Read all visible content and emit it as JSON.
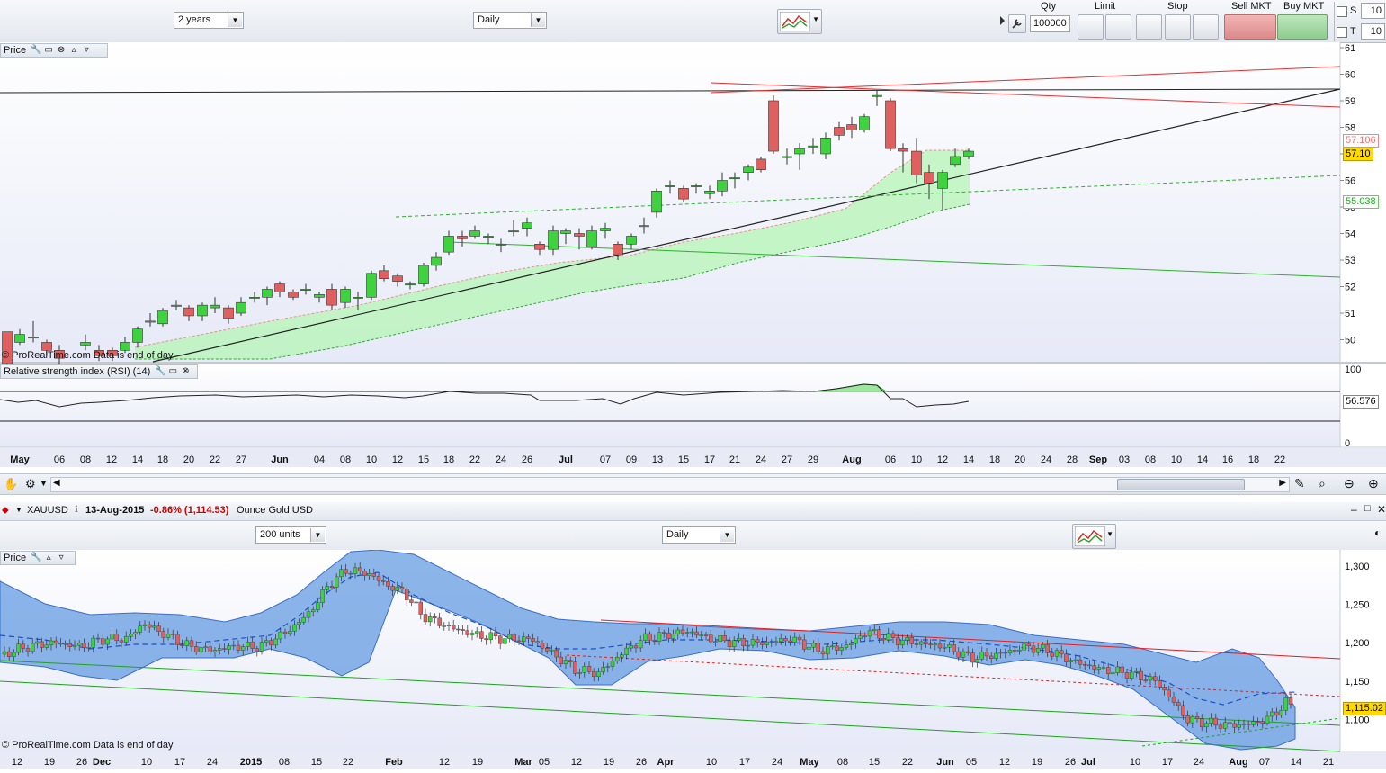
{
  "top_toolbar": {
    "period_select": "2 years",
    "interval_select": "Daily",
    "qty_label": "Qty",
    "qty_value": "100000",
    "limit_label": "Limit",
    "stop_label": "Stop",
    "sell_label": "Sell MKT",
    "buy_label": "Buy MKT",
    "s_label": "S",
    "s_value": "10",
    "t_label": "T",
    "t_value": "10"
  },
  "upper_chart": {
    "price_panel_title": "Price",
    "watermark": "© ProRealTime.com  Data is end of day",
    "y_ticks": [
      "61",
      "60",
      "59",
      "58",
      "57",
      "56",
      "55",
      "54",
      "53",
      "52",
      "51",
      "50"
    ],
    "price_box_last": "57.10",
    "price_box_red": "57.106",
    "price_box_green": "55.038",
    "rsi_title": "Relative strength index (RSI) (14)",
    "rsi_ticks": [
      "100",
      "0"
    ],
    "rsi_value": "56.576",
    "x_ticks": [
      "May",
      "06",
      "08",
      "12",
      "14",
      "18",
      "20",
      "22",
      "27",
      "Jun",
      "04",
      "08",
      "10",
      "12",
      "15",
      "18",
      "22",
      "24",
      "26",
      "Jul",
      "07",
      "09",
      "13",
      "15",
      "17",
      "21",
      "24",
      "27",
      "29",
      "Aug",
      "06",
      "10",
      "12",
      "14",
      "18",
      "20",
      "24",
      "28",
      "Sep",
      "03",
      "08",
      "10",
      "14",
      "16",
      "18",
      "22"
    ],
    "colors": {
      "up": "#3fd23f",
      "down": "#e06060",
      "band": "#b6f5b6",
      "trend": "#222222",
      "red_line": "#e03030",
      "green_line": "#30b030"
    }
  },
  "lower_header": {
    "symbol": "XAUUSD",
    "date": "13-Aug-2015",
    "change": "-0.86% (1,114.53)",
    "name": "Ounce Gold USD",
    "units_select": "200 units",
    "interval_select": "Daily"
  },
  "lower_chart": {
    "price_panel_title": "Price",
    "watermark": "© ProRealTime.com  Data is end of day",
    "y_ticks": [
      "1,300",
      "1,250",
      "1,200",
      "1,150",
      "1,100"
    ],
    "price_box_last": "1,115.02",
    "x_ticks": [
      "12",
      "19",
      "26",
      "Dec",
      "10",
      "17",
      "24",
      "2015",
      "08",
      "15",
      "22",
      "Feb",
      "12",
      "19",
      "Mar",
      "05",
      "12",
      "19",
      "26",
      "Apr",
      "10",
      "17",
      "24",
      "May",
      "08",
      "15",
      "22",
      "Jun",
      "05",
      "12",
      "19",
      "26",
      "Jul",
      "10",
      "17",
      "24",
      "Aug",
      "07",
      "14",
      "21"
    ],
    "colors": {
      "band": "#5b95e0",
      "mid": "#1d4fc4",
      "red_line": "#e02020",
      "green_line": "#20a020"
    }
  }
}
